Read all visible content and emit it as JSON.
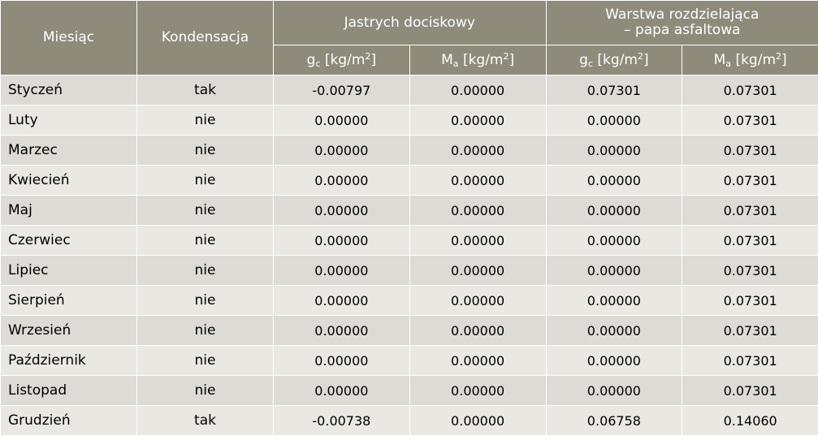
{
  "table": {
    "headers": {
      "month": "Miesiąc",
      "condensation": "Kondensacja",
      "group1": "Jastrych dociskowy",
      "group2_line1": "Warstwa rozdzielająca",
      "group2_line2": "– papa asfaltowa",
      "g_sym": "g",
      "g_sub": "c",
      "m_sym": "M",
      "m_sub": "a",
      "unit": "[kg/m",
      "unit_exp": "2",
      "unit_end": "]"
    },
    "rows": [
      [
        "Styczeń",
        "tak",
        "-0.00797",
        "0.00000",
        "0.07301",
        "0.07301"
      ],
      [
        "Luty",
        "nie",
        "0.00000",
        "0.00000",
        "0.00000",
        "0.07301"
      ],
      [
        "Marzec",
        "nie",
        "0.00000",
        "0.00000",
        "0.00000",
        "0.07301"
      ],
      [
        "Kwiecień",
        "nie",
        "0.00000",
        "0.00000",
        "0.00000",
        "0.07301"
      ],
      [
        "Maj",
        "nie",
        "0.00000",
        "0.00000",
        "0.00000",
        "0.07301"
      ],
      [
        "Czerwiec",
        "nie",
        "0.00000",
        "0.00000",
        "0.00000",
        "0.07301"
      ],
      [
        "Lipiec",
        "nie",
        "0.00000",
        "0.00000",
        "0.00000",
        "0.07301"
      ],
      [
        "Sierpień",
        "nie",
        "0.00000",
        "0.00000",
        "0.00000",
        "0.07301"
      ],
      [
        "Wrzesień",
        "nie",
        "0.00000",
        "0.00000",
        "0.00000",
        "0.07301"
      ],
      [
        "Październik",
        "nie",
        "0.00000",
        "0.00000",
        "0.00000",
        "0.07301"
      ],
      [
        "Listopad",
        "nie",
        "0.00000",
        "0.00000",
        "0.00000",
        "0.07301"
      ],
      [
        "Grudzień",
        "tak",
        "-0.00738",
        "0.00000",
        "0.06758",
        "0.14060"
      ]
    ]
  },
  "colors": {
    "header_bg": "#8e8b7b",
    "row_odd": "#dcdbd5",
    "row_even": "#e9e8e3"
  }
}
